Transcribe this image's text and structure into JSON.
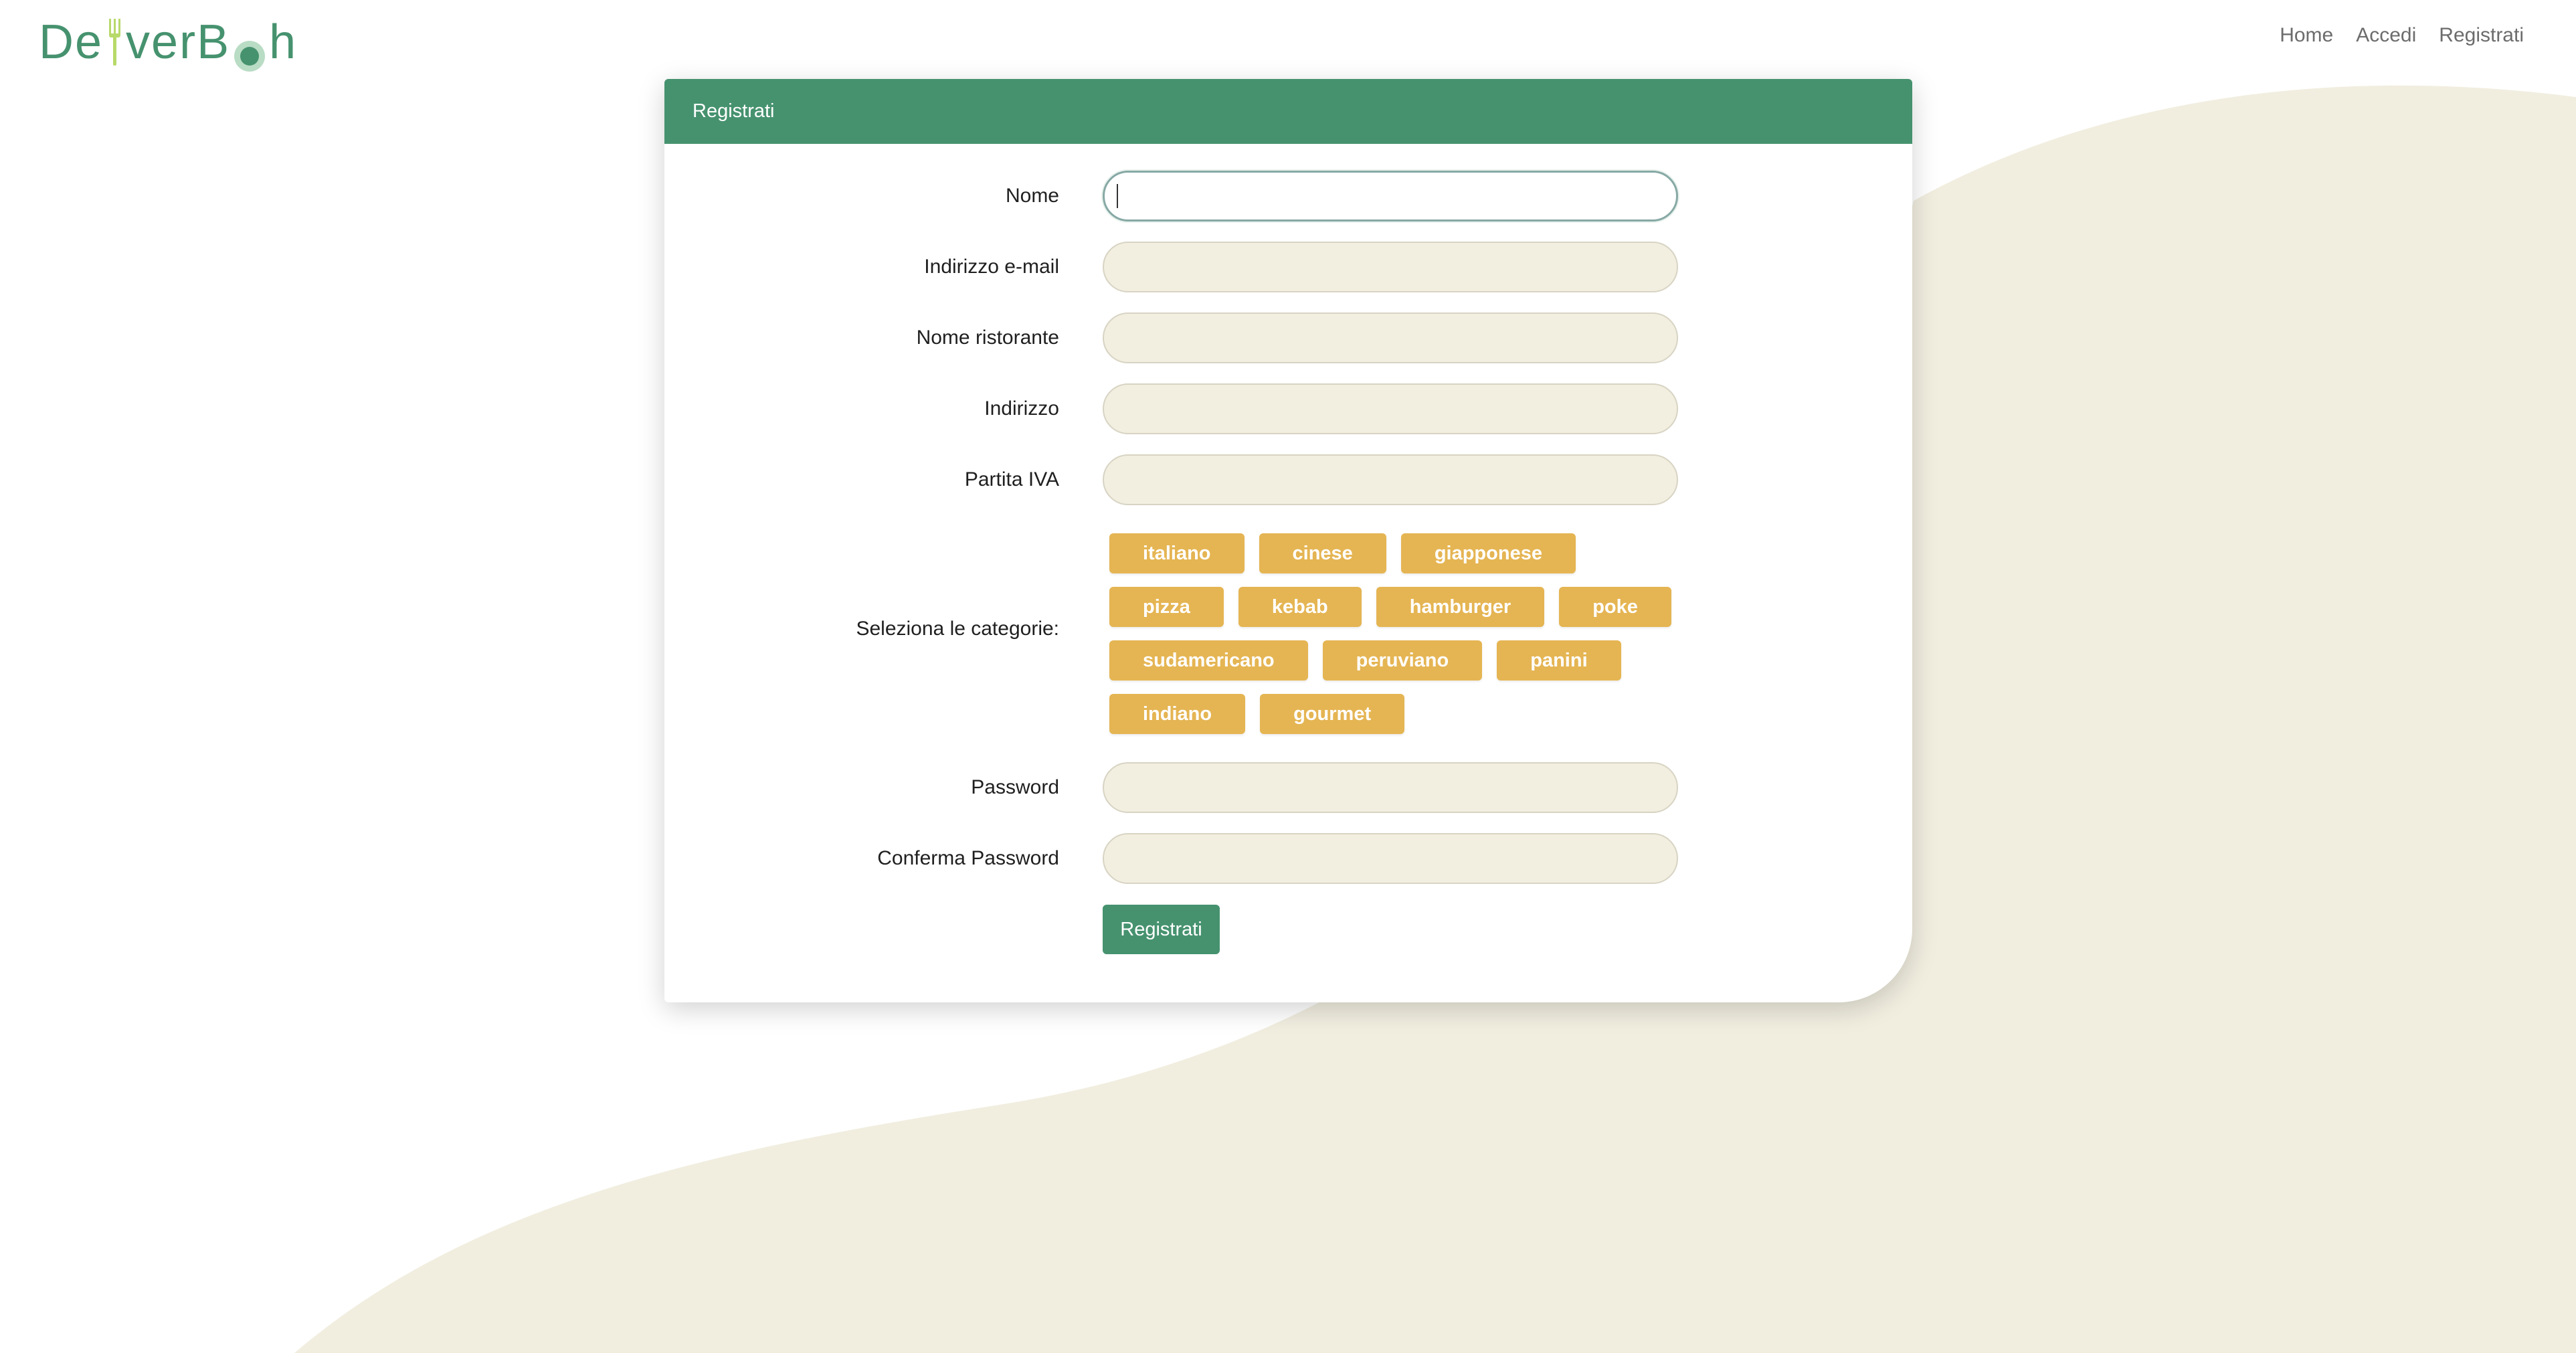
{
  "brand": {
    "logo_text_1": "De",
    "logo_text_2": "verB",
    "logo_text_3": "h",
    "accent": "#46926f",
    "chip_color": "#e5b553",
    "input_bg": "#f2eee0",
    "wave_color": "#f1eee0"
  },
  "nav": {
    "links": [
      "Home",
      "Accedi",
      "Registrati"
    ]
  },
  "card": {
    "title": "Registrati"
  },
  "form": {
    "fields": [
      {
        "label": "Nome",
        "value": "",
        "focused": true
      },
      {
        "label": "Indirizzo e-mail",
        "value": ""
      },
      {
        "label": "Nome ristorante",
        "value": ""
      },
      {
        "label": "Indirizzo",
        "value": ""
      },
      {
        "label": "Partita IVA",
        "value": ""
      }
    ],
    "categories_label": "Seleziona le categorie:",
    "categories": [
      "italiano",
      "cinese",
      "giapponese",
      "pizza",
      "kebab",
      "hamburger",
      "poke",
      "sudamericano",
      "peruviano",
      "panini",
      "indiano",
      "gourmet"
    ],
    "password_fields": [
      {
        "label": "Password",
        "value": ""
      },
      {
        "label": "Conferma Password",
        "value": ""
      }
    ],
    "submit_label": "Registrati"
  }
}
